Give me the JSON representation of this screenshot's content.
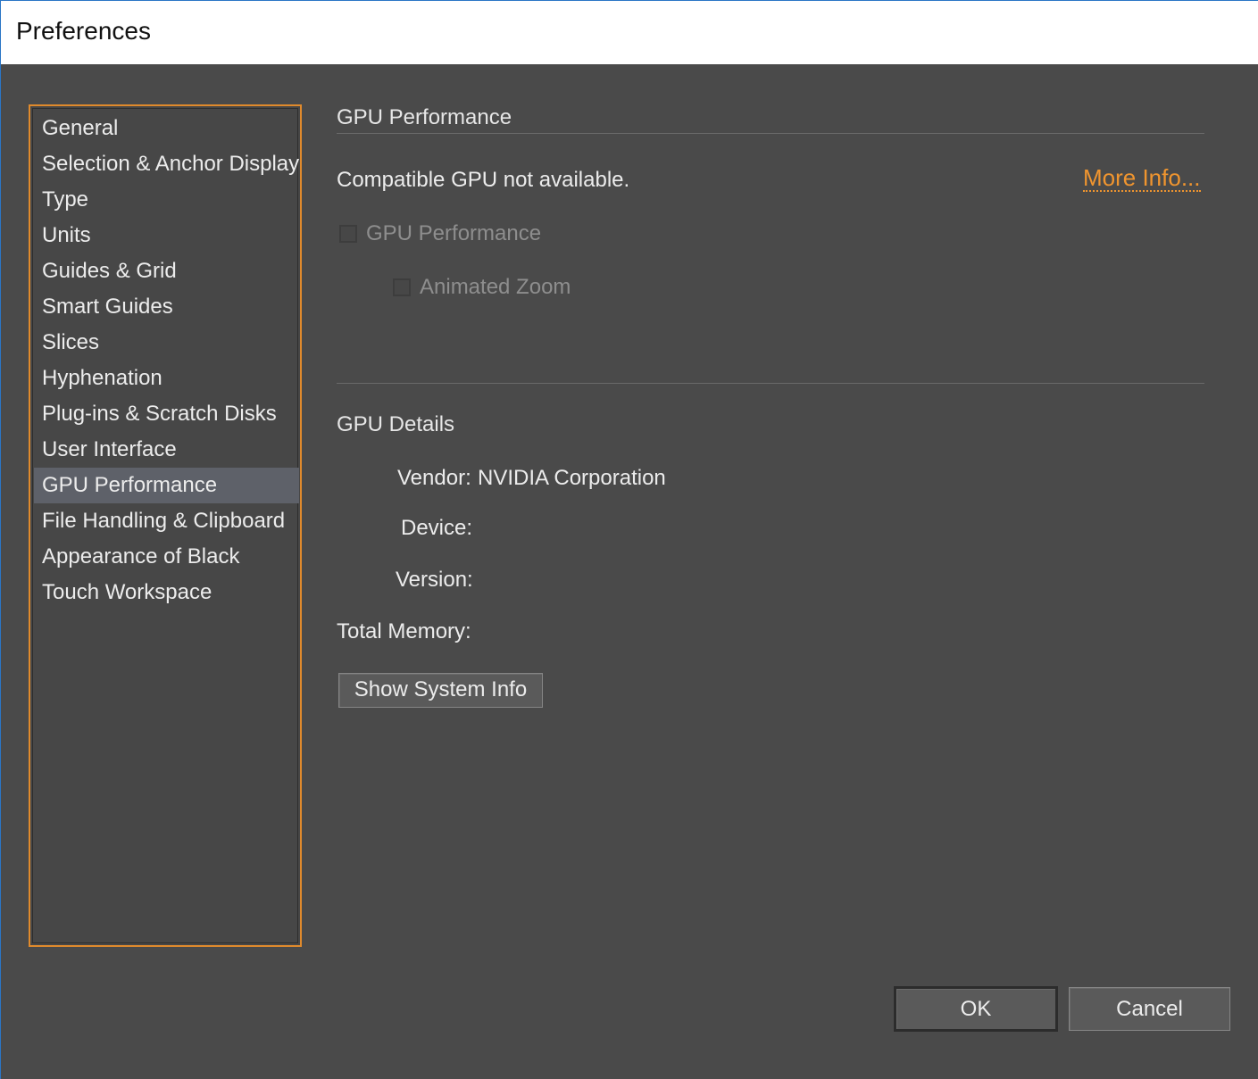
{
  "window": {
    "title": "Preferences"
  },
  "sidebar": {
    "items": [
      {
        "label": "General",
        "selected": false
      },
      {
        "label": "Selection & Anchor Display",
        "selected": false
      },
      {
        "label": "Type",
        "selected": false
      },
      {
        "label": "Units",
        "selected": false
      },
      {
        "label": "Guides & Grid",
        "selected": false
      },
      {
        "label": "Smart Guides",
        "selected": false
      },
      {
        "label": "Slices",
        "selected": false
      },
      {
        "label": "Hyphenation",
        "selected": false
      },
      {
        "label": "Plug-ins & Scratch Disks",
        "selected": false
      },
      {
        "label": "User Interface",
        "selected": false
      },
      {
        "label": "GPU Performance",
        "selected": true
      },
      {
        "label": "File Handling & Clipboard",
        "selected": false
      },
      {
        "label": "Appearance of Black",
        "selected": false
      },
      {
        "label": "Touch Workspace",
        "selected": false
      }
    ]
  },
  "main": {
    "section_title": "GPU Performance",
    "status_text": "Compatible GPU not available.",
    "more_info_link": "More Info...",
    "gpu_checkbox_label": "GPU Performance",
    "gpu_checkbox_checked": false,
    "animated_zoom_label": "Animated Zoom",
    "animated_zoom_checked": false,
    "details_title": "GPU Details",
    "vendor_label": "Vendor:",
    "vendor_value": "NVIDIA Corporation",
    "device_label": "Device:",
    "device_value": "",
    "version_label": "Version:",
    "version_value": "",
    "total_memory_label": "Total Memory:",
    "total_memory_value": "",
    "show_system_info_button": "Show System Info"
  },
  "footer": {
    "ok_button": "OK",
    "cancel_button": "Cancel"
  },
  "colors": {
    "accent": "#e08a2c",
    "link": "#f0952f",
    "selection": "#5e6169",
    "panel_background": "#4a4a4a"
  }
}
